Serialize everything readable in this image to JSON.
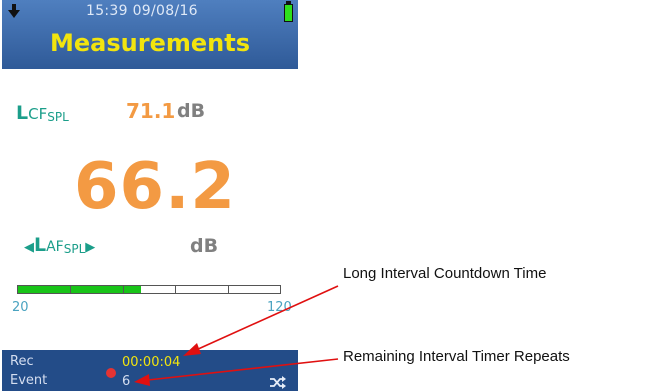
{
  "status": {
    "time": "15:39  09/08/16"
  },
  "header": {
    "title": "Measurements"
  },
  "primary": {
    "label_main": "L",
    "label_mid": "CF",
    "label_sub": "SPL",
    "value": "71.1",
    "unit": "dB"
  },
  "main": {
    "value": "66.2",
    "label_main": "L",
    "label_mid": "AF",
    "label_sub": "SPL",
    "unit": "dB",
    "arrow_left": "◀",
    "arrow_right": "▶"
  },
  "bargraph": {
    "min_label": "20",
    "max_label": "120",
    "level_fraction": 0.47,
    "segments": 5
  },
  "footer": {
    "rec_label": "Rec",
    "event_label": "Event",
    "countdown": "00:00:04",
    "repeats": "6"
  },
  "annotations": {
    "countdown": "Long Interval Countdown Time",
    "repeats": "Remaining Interval Timer Repeats"
  },
  "colors": {
    "header_bg": "#3b6aad",
    "title": "#f2e40e",
    "teal": "#1b9e8a",
    "orange": "#f39a43",
    "bar_green": "#18c418",
    "footer_bg": "#234c88",
    "arrow_red": "#e01010"
  },
  "icons": [
    "download-arrow-icon",
    "battery-icon",
    "record-dot-icon",
    "shuffle-icon"
  ]
}
